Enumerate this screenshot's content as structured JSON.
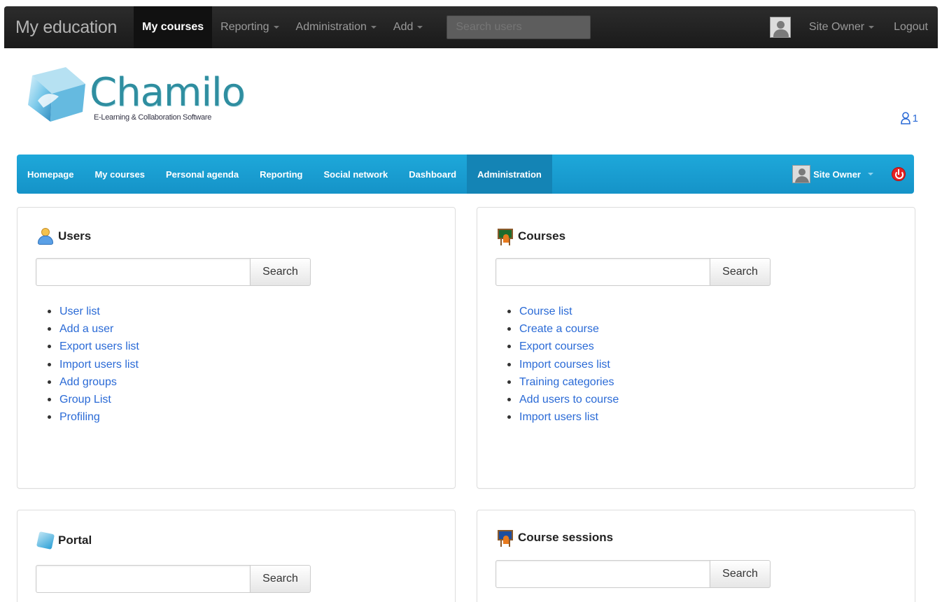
{
  "topbar": {
    "brand": "My education",
    "nav": [
      {
        "label": "My courses",
        "active": true,
        "dropdown": false
      },
      {
        "label": "Reporting",
        "active": false,
        "dropdown": true
      },
      {
        "label": "Administration",
        "active": false,
        "dropdown": true
      },
      {
        "label": "Add",
        "active": false,
        "dropdown": true
      }
    ],
    "search_placeholder": "Search users",
    "user_label": "Site Owner",
    "logout_label": "Logout"
  },
  "header": {
    "logo_text": "Chamilo",
    "logo_subtitle": "E-Learning & Collaboration Software",
    "notification_count": "1"
  },
  "mainnav": {
    "items": [
      {
        "label": "Homepage",
        "active": false
      },
      {
        "label": "My courses",
        "active": false
      },
      {
        "label": "Personal agenda",
        "active": false
      },
      {
        "label": "Reporting",
        "active": false
      },
      {
        "label": "Social network",
        "active": false
      },
      {
        "label": "Dashboard",
        "active": false
      },
      {
        "label": "Administration",
        "active": true
      }
    ],
    "user_label": "Site Owner"
  },
  "panels": {
    "users": {
      "title": "Users",
      "search_button": "Search",
      "links": [
        "User list",
        "Add a user",
        "Export users list",
        "Import users list",
        "Add groups",
        "Group List",
        "Profiling"
      ]
    },
    "courses": {
      "title": "Courses",
      "search_button": "Search",
      "links": [
        "Course list",
        "Create a course",
        "Export courses",
        "Import courses list",
        "Training categories",
        "Add users to course",
        "Import users list"
      ]
    },
    "portal": {
      "title": "Portal",
      "search_button": "Search"
    },
    "sessions": {
      "title": "Course sessions",
      "search_button": "Search"
    }
  },
  "colors": {
    "topbar": "#1f1f1f",
    "mainnav": "#1ba0d6",
    "link": "#2a6ad6",
    "logo": "#2f8ea0"
  }
}
